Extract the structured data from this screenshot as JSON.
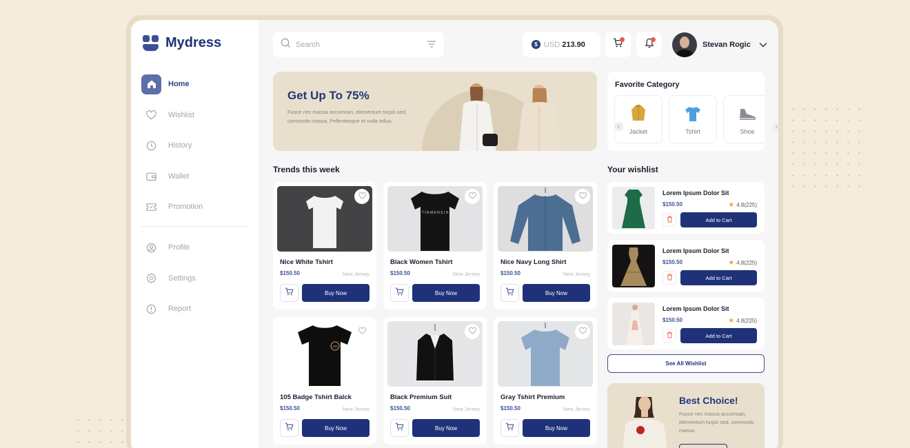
{
  "app": {
    "name": "Mydress"
  },
  "sidebar": {
    "items": [
      {
        "label": "Home",
        "icon": "home-icon",
        "active": true
      },
      {
        "label": "Wishlist",
        "icon": "heart-icon"
      },
      {
        "label": "History",
        "icon": "clock-icon"
      },
      {
        "label": "Wallet",
        "icon": "wallet-icon"
      },
      {
        "label": "Promotion",
        "icon": "ticket-icon"
      },
      {
        "label": "Profile",
        "icon": "user-icon"
      },
      {
        "label": "Settings",
        "icon": "gear-icon"
      },
      {
        "label": "Report",
        "icon": "info-icon"
      }
    ]
  },
  "search": {
    "placeholder": "Search"
  },
  "balance": {
    "currency": "USD",
    "amount": "213.90"
  },
  "user": {
    "name": "Stevan Rogic"
  },
  "banner": {
    "title": "Get Up To 75%",
    "text": "Fusce nec massa accumsan, elementum turpis sed, commodo massa. Pellentesque et nulla tellus."
  },
  "favorite": {
    "title": "Favorite Category",
    "categories": [
      "Jacket",
      "Tshirt",
      "Shoe"
    ]
  },
  "trends": {
    "title": "Trends this week",
    "buy_label": "Buy Now",
    "products": [
      {
        "name": "Nice White Tshirt",
        "price": "$150.50",
        "location": "New Jersey"
      },
      {
        "name": "Black Women Tshirt",
        "price": "$150.50",
        "location": "New Jersey"
      },
      {
        "name": "Nice Navy Long Shirt",
        "price": "$150.50",
        "location": "New Jersey"
      },
      {
        "name": "105 Badge Tshirt Balck",
        "price": "$150.50",
        "location": "New Jersey"
      },
      {
        "name": "Black Premium Suit",
        "price": "$150.50",
        "location": "New Jersey"
      },
      {
        "name": "Gray Tshirt Premium",
        "price": "$150.50",
        "location": "New Jersey"
      }
    ]
  },
  "wishlist": {
    "title": "Your wishlist",
    "add_label": "Add to Cart",
    "see_all": "See All Wishlist",
    "items": [
      {
        "name": "Lorem Ipsum Dolor Sit",
        "price": "$150.50",
        "rating": "4.8(225)"
      },
      {
        "name": "Lorem Ipsum Dolor Sit",
        "price": "$150.50",
        "rating": "4.8(225)"
      },
      {
        "name": "Lorem Ipsum Dolor Sit",
        "price": "$150.50",
        "rating": "4.8(225)"
      }
    ]
  },
  "best": {
    "title": "Best Choice!",
    "text": "Fusce nec massa accumsan, elementum turpis sed, commodo massa."
  },
  "colors": {
    "primary": "#1f3279",
    "accent": "#ea5c42",
    "banner": "#e8dfcd",
    "star": "#f0a735"
  }
}
